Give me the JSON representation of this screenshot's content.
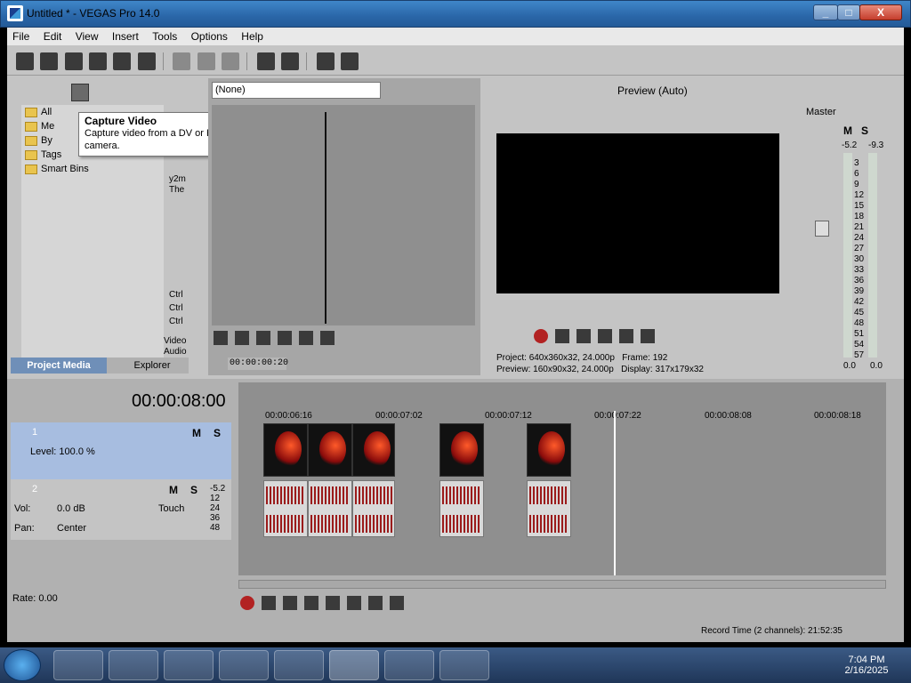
{
  "window": {
    "title": "Untitled * - VEGAS Pro 14.0",
    "min": "_",
    "max": "□",
    "close": "X"
  },
  "menu": [
    "File",
    "Edit",
    "View",
    "Insert",
    "Tools",
    "Options",
    "Help"
  ],
  "tooltip": {
    "title": "Capture Video",
    "text": "Capture video from a DV or HDV camera."
  },
  "project_media": {
    "tree": [
      {
        "label": "All"
      },
      {
        "label": "Me"
      },
      {
        "label": "By"
      },
      {
        "label": "Tags"
      },
      {
        "label": "Smart Bins"
      }
    ],
    "list_text": [
      "y2m",
      "The",
      "Ctrl",
      "Ctrl",
      "Ctrl",
      "Video",
      "Audio"
    ],
    "tabs": [
      "Project Media",
      "Explorer"
    ]
  },
  "trimmer": {
    "dropdown": "(None)",
    "timecode": "00:00:00:20"
  },
  "preview": {
    "mode": "Preview (Auto)",
    "project_label": "Project:",
    "project_value": "640x360x32, 24.000p",
    "frame_label": "Frame:",
    "frame_value": "192",
    "preview_label": "Preview:",
    "preview_value": "160x90x32, 24.000p",
    "display_label": "Display:",
    "display_value": "317x179x32"
  },
  "mixer": {
    "title": "Master",
    "levels": [
      "-5.2",
      "-9.3"
    ],
    "m": "M",
    "s": "S",
    "ticks": [
      "3",
      "6",
      "9",
      "12",
      "15",
      "18",
      "21",
      "24",
      "27",
      "30",
      "33",
      "36",
      "39",
      "42",
      "45",
      "48",
      "51",
      "54",
      "57"
    ],
    "bottom": [
      "0.0",
      "0.0"
    ]
  },
  "timeline": {
    "timecode": "00:00:08:00",
    "ruler": [
      "00:00:06:16",
      "00:00:07:02",
      "00:00:07:12",
      "00:00:07:22",
      "00:00:08:08",
      "00:00:08:18"
    ],
    "track1": {
      "num": "1",
      "level": "Level: 100.0 %",
      "m": "M",
      "s": "S"
    },
    "track2": {
      "num": "2",
      "vol_label": "Vol:",
      "vol": "0.0 dB",
      "pan_label": "Pan:",
      "pan": "Center",
      "touch": "Touch",
      "m": "M",
      "s": "S",
      "meter": [
        "-5.2",
        "12",
        "24",
        "36",
        "48"
      ]
    },
    "rate": "Rate: 0.00",
    "status": "Record Time (2 channels): 21:52:35"
  },
  "taskbar": {
    "time": "7:04 PM",
    "date": "2/16/2025"
  }
}
